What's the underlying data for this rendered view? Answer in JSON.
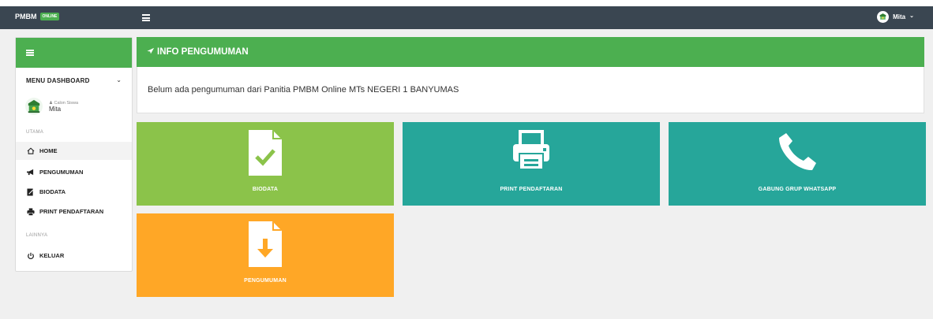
{
  "topbar": {
    "brand": "PMBM",
    "badge": "ONLINE",
    "user_name": "Mita",
    "user_chevron": "⌄"
  },
  "sidebar": {
    "menu_title": "MENU DASHBOARD",
    "chevron": "⌄",
    "profile_role": "Calon Siswa",
    "profile_name": "Mita",
    "section_main": "UTAMA",
    "section_other": "LAINNYA",
    "items": [
      {
        "label": "HOME",
        "icon": "home-icon"
      },
      {
        "label": "PENGUMUMAN",
        "icon": "megaphone-icon"
      },
      {
        "label": "BIODATA",
        "icon": "edit-icon"
      },
      {
        "label": "PRINT PENDAFTARAN",
        "icon": "print-icon"
      },
      {
        "label": "KELUAR",
        "icon": "power-icon"
      }
    ]
  },
  "info": {
    "title": "INFO PENGUMUMAN",
    "message": "Belum ada pengumuman dari Panitia PMBM Online MTs NEGERI 1 BANYUMAS"
  },
  "tiles": [
    {
      "label": "BIODATA",
      "icon": "file-check-icon",
      "color": "#8bc34a"
    },
    {
      "label": "PRINT PENDAFTARAN",
      "icon": "printer-icon",
      "color": "#26a69a"
    },
    {
      "label": "GABUNG GRUP WHATSAPP",
      "icon": "phone-icon",
      "color": "#26a69a"
    },
    {
      "label": "PENGUMUMAN",
      "icon": "file-download-icon",
      "color": "#ffa726"
    }
  ],
  "colors": {
    "topbar": "#3a4651",
    "primary_green": "#4caf50",
    "light_green": "#8bc34a",
    "teal": "#26a69a",
    "orange": "#ffa726"
  }
}
